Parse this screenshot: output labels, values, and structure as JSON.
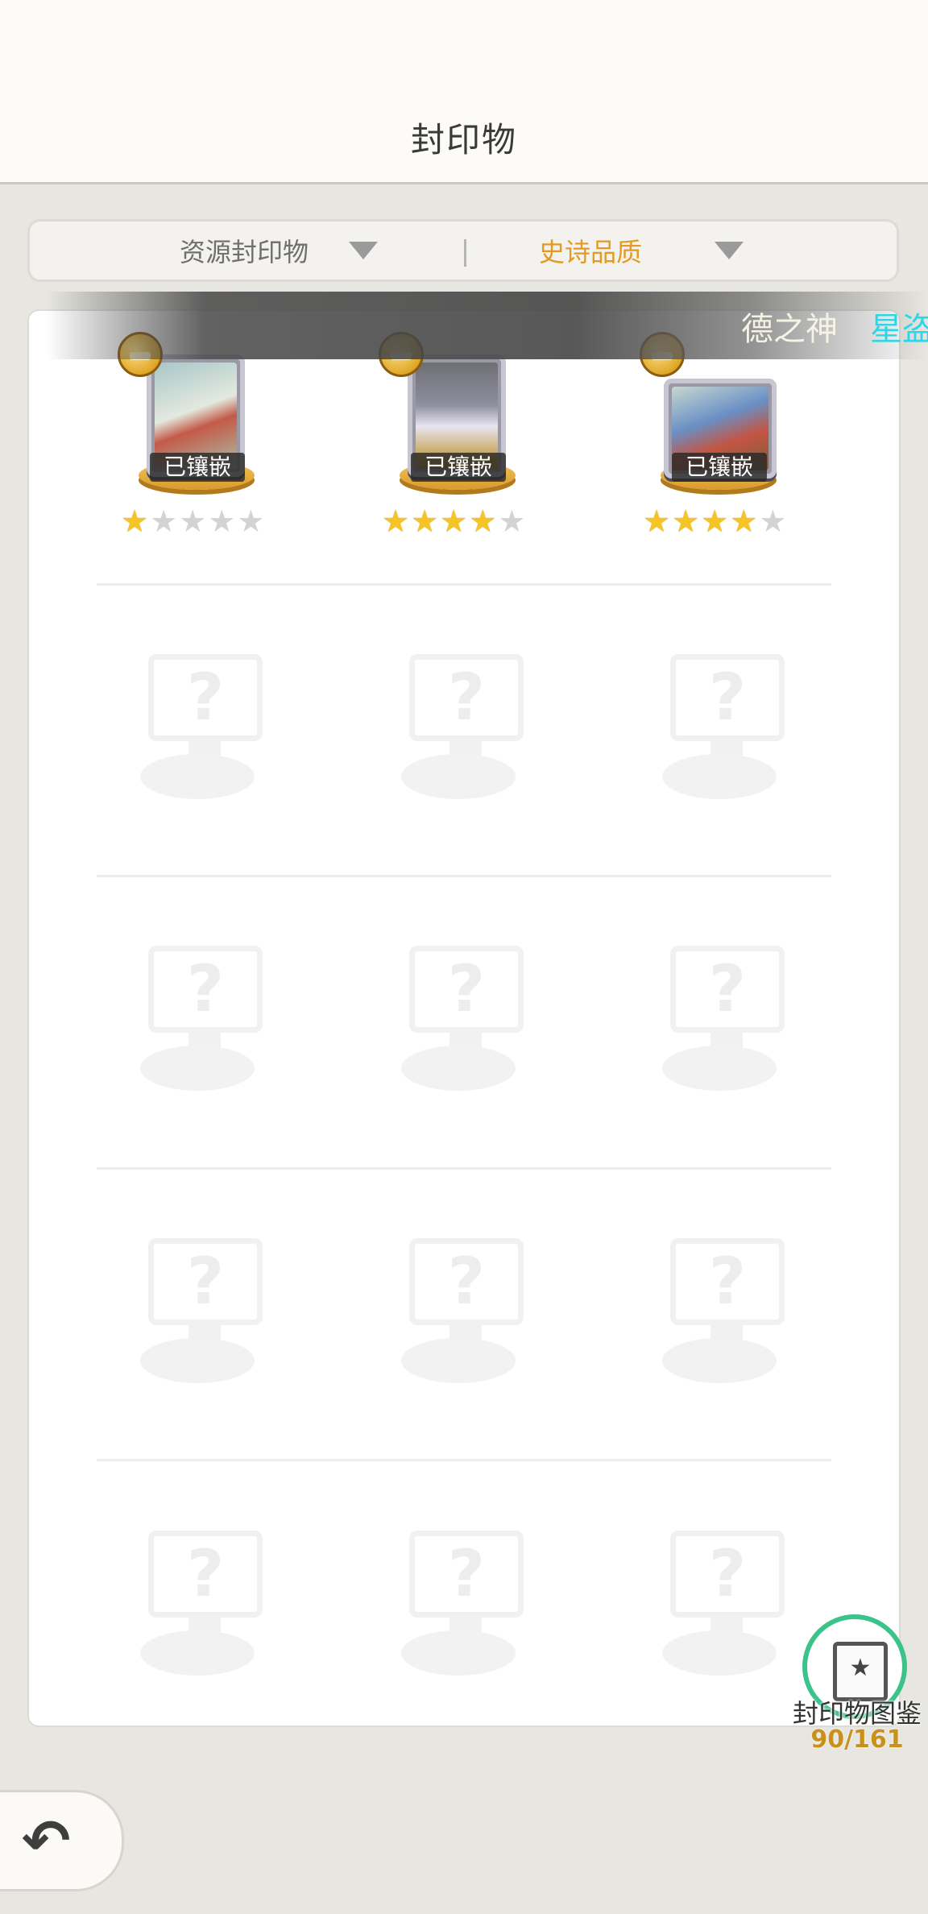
{
  "header": {
    "title": "封印物"
  },
  "filters": [
    {
      "label": "资源封印物",
      "icon": "dropdown-triangle-icon"
    },
    {
      "label": "史诗品质",
      "icon": "dropdown-triangle-icon",
      "accent": "#e39a22"
    }
  ],
  "banner": {
    "text": "德之神",
    "highlight": "星盗"
  },
  "seals": [
    {
      "badge": "已镶嵌",
      "stars": 1,
      "max_stars": 5
    },
    {
      "badge": "已镶嵌",
      "stars": 4,
      "max_stars": 5
    },
    {
      "badge": "已镶嵌",
      "stars": 4,
      "max_stars": 5
    }
  ],
  "placeholder_symbol": "?",
  "codex": {
    "label": "封印物图鉴",
    "count": "90/161",
    "icon": "book-star-icon"
  },
  "footer": {
    "back_icon": "back-arrow-icon"
  },
  "colors": {
    "accent": "#e39a22",
    "star_on": "#f6c425",
    "star_off": "#d3d3d3",
    "codex_ring": "#3bc38a",
    "count": "#c9911a",
    "highlight": "#2ad7e8"
  }
}
